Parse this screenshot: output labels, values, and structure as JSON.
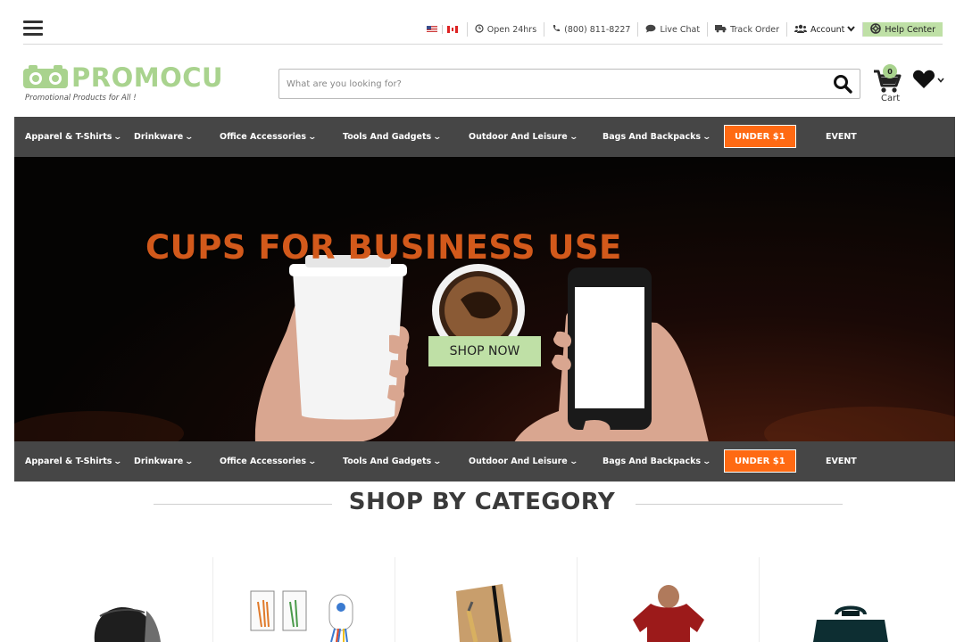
{
  "header": {
    "utility": {
      "hours": "Open 24hrs",
      "phone": "(800) 811-8227",
      "chat": "Live Chat",
      "track": "Track Order",
      "account": "Account",
      "help": "Help Center"
    },
    "logo": {
      "name": "PROMOCU",
      "tagline": "Promotional Products for All !"
    },
    "search": {
      "placeholder": "What are you looking for?"
    },
    "cart": {
      "count": "0",
      "label": "Cart"
    }
  },
  "nav": {
    "items": [
      {
        "label": "Apparel & T-Shirts"
      },
      {
        "label": "Drinkware"
      },
      {
        "label": "Office Accessories"
      },
      {
        "label": "Tools And Gadgets"
      },
      {
        "label": "Outdoor And Leisure"
      },
      {
        "label": "Bags And Backpacks"
      }
    ],
    "under": "UNDER $1",
    "event": "EVENT"
  },
  "hero": {
    "title": "CUPS FOR BUSINESS USE",
    "cta": "SHOP NOW"
  },
  "categories": {
    "title": "SHOP BY CATEGORY",
    "items": [
      "cap-icon",
      "pen-set-icon",
      "notebook-icon",
      "tshirt-icon",
      "bag-icon"
    ]
  },
  "colors": {
    "accent_green": "#a9d38e",
    "nav_bg": "#464646",
    "under_orange": "#ff6a13",
    "hero_title": "#d2591b"
  }
}
